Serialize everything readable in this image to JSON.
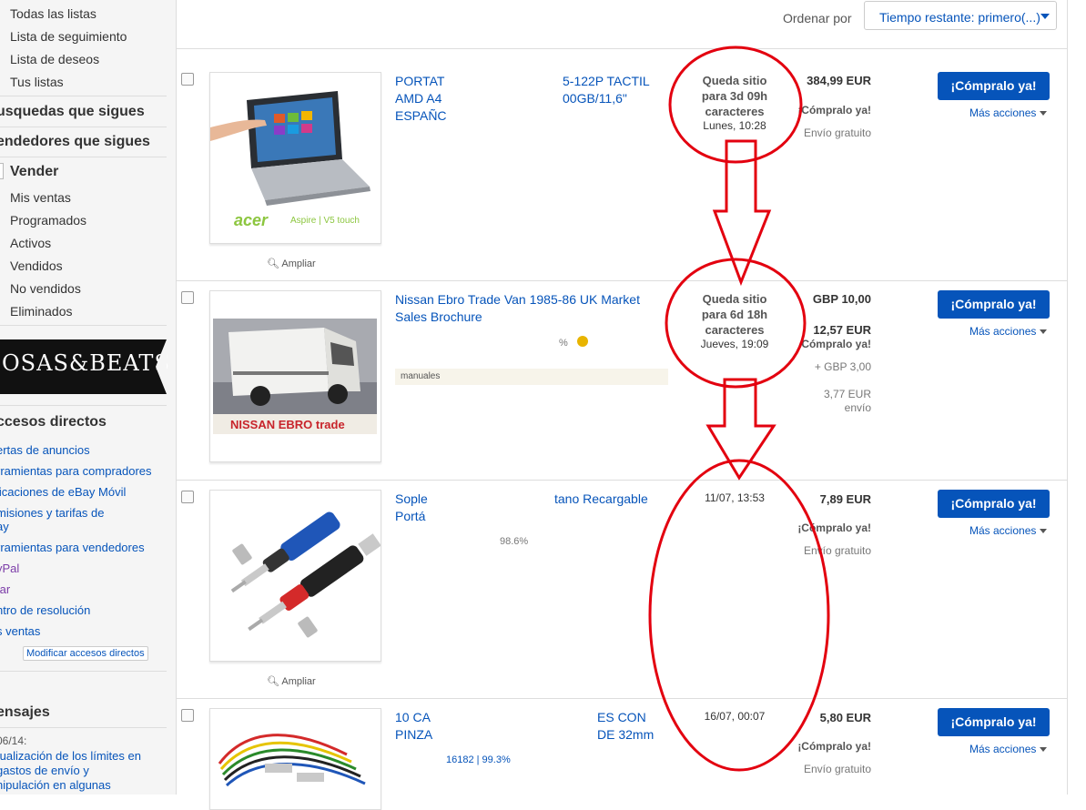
{
  "sidebar": {
    "lists": [
      "Todas las listas",
      "Lista de seguimiento",
      "Lista de deseos",
      "Tus listas"
    ],
    "followed_searches": "usquedas que sigues",
    "followed_sellers": "endedores que sigues",
    "sell_heading": "Vender",
    "sell_items": [
      "Mis ventas",
      "Programados",
      "Activos",
      "Vendidos",
      "No vendidos",
      "Eliminados"
    ],
    "banner_text": "OSAS&BEATS",
    "shortcuts_heading": "ccesos directos",
    "shortcuts": [
      "ertas de anuncios",
      "rramientas para compradores",
      "licaciones de eBay Móvil",
      "misiones y tarifas de",
      "ay",
      "rramientas para vendedores",
      "yPal",
      "tar",
      "ntro de resolución",
      "s ventas"
    ],
    "modify_shortcuts": "Modificar accesos directos",
    "messages_heading": "ensajes",
    "message_date": "06/14:",
    "message_lines": [
      "tualización de los límites en",
      "gastos de envío y",
      "nipulación en algunas"
    ]
  },
  "header": {
    "sort_label": "Ordenar por",
    "sort_value": "Tiempo restante: primero(...)"
  },
  "listings": [
    {
      "title_lines": [
        "PORTAT",
        "AMD A4",
        "ESPAÑC"
      ],
      "title_right": [
        "5-122P TACTIL",
        "00GB/11,6\""
      ],
      "zoom": "Ampliar",
      "time_status": [
        "Queda sitio",
        "para 3d 09h",
        "caracteres"
      ],
      "time_date": "Lunes, 10:28",
      "price": "384,99 EUR",
      "format": "¡Cómpralo ya!",
      "shipping": "Envío gratuito",
      "buy_label": "¡Cómpralo ya!",
      "more_label": "Más acciones",
      "thumb_brand": "acer",
      "thumb_model": "Aspire | V5 touch"
    },
    {
      "title_lines": [
        "Nissan Ebro Trade Van 1985-86 UK Market",
        "Sales Brochure"
      ],
      "seller_pct": "%",
      "tag": "manuales",
      "time_status": [
        "Queda sitio",
        "para 6d 18h",
        "caracteres"
      ],
      "time_date": "Jueves, 19:09",
      "price": "GBP 10,00",
      "price_converted": "12,57 EUR",
      "format": "Cómpralo ya!",
      "shipping_gbp": "+ GBP 3,00",
      "shipping_eur": "3,77 EUR",
      "shipping_word": "envío",
      "buy_label": "¡Cómpralo ya!",
      "more_label": "Más acciones",
      "thumb_brand": "NISSAN EBRO trade"
    },
    {
      "title_lines": [
        "Sople",
        "Portá"
      ],
      "title_right": [
        "tano Recargable"
      ],
      "seller_pct": "98.6%",
      "zoom": "Ampliar",
      "time_date": "11/07, 13:53",
      "price": "7,89 EUR",
      "format": "¡Cómpralo ya!",
      "shipping": "Envío gratuito",
      "buy_label": "¡Cómpralo ya!",
      "more_label": "Más acciones"
    },
    {
      "title_lines": [
        "10 CA",
        "PINZA"
      ],
      "title_right": [
        "ES CON",
        "DE 32mm"
      ],
      "seller": "16182 | 99.3%",
      "time_date": "16/07, 00:07",
      "price": "5,80 EUR",
      "format": "¡Cómpralo ya!",
      "shipping": "Envío gratuito",
      "buy_label": "¡Cómpralo ya!",
      "more_label": "Más acciones"
    }
  ],
  "colors": {
    "link": "#0654ba",
    "button": "#0654ba",
    "annotation": "#e3000f"
  }
}
